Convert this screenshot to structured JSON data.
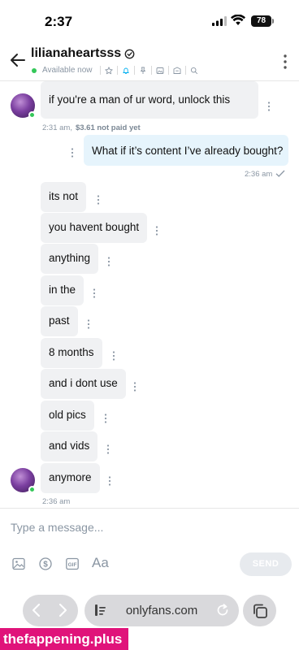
{
  "status": {
    "time": "2:37",
    "battery": "78"
  },
  "header": {
    "username": "lilianaheartsss",
    "availability": "Available now"
  },
  "messages": [
    {
      "text": "if you're a man of ur word, unlock this",
      "time": "2:31 am,",
      "price": "$3.61 not paid yet"
    },
    {
      "text": "What if it’s content I’ve already bought?",
      "time": "2:36 am"
    },
    {
      "text": "its not"
    },
    {
      "text": "you havent bought"
    },
    {
      "text": "anything"
    },
    {
      "text": "in the"
    },
    {
      "text": "past"
    },
    {
      "text": "8 months"
    },
    {
      "text": "and i dont use"
    },
    {
      "text": "old pics"
    },
    {
      "text": "and vids"
    },
    {
      "text": "anymore",
      "time": "2:36 am"
    }
  ],
  "composer": {
    "placeholder": "Type a message...",
    "send_label": "SEND",
    "gif_label": "GIF",
    "text_label": "Aa"
  },
  "browser": {
    "url": "onlyfans.com"
  },
  "watermark": "thefappening.plus",
  "colors": {
    "online": "#34c759",
    "outgoing_bubble": "#e6f4fc",
    "incoming_bubble": "#f0f1f3",
    "watermark": "#e0137a"
  }
}
